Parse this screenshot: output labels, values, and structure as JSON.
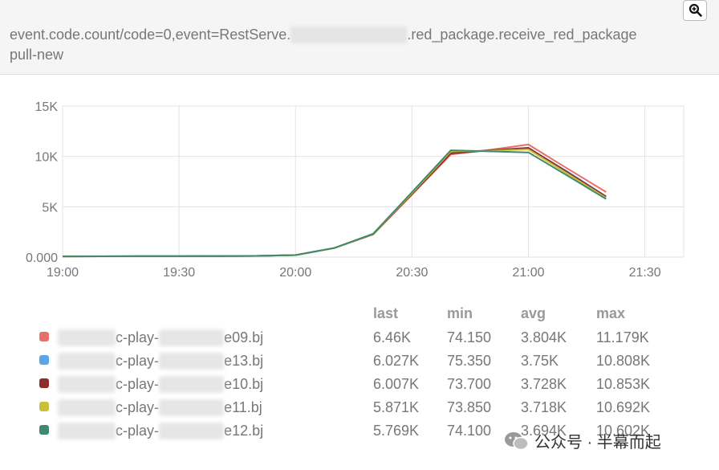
{
  "header": {
    "title_prefix": "event.code.count/code=0,event=RestServe.",
    "title_suffix": ".red_package.receive_red_package",
    "title_line2": "pull-new",
    "zoom_icon": "zoom-in-icon"
  },
  "legend": {
    "columns": [
      "last",
      "min",
      "avg",
      "max"
    ],
    "rows": [
      {
        "name_visible": "c-play-",
        "name_suffix": "e09.bj",
        "color": "#e8706a",
        "last": "6.46K",
        "min": "74.150",
        "avg": "3.804K",
        "max": "11.179K"
      },
      {
        "name_visible": "c-play-",
        "name_suffix": "e13.bj",
        "color": "#5aa7e8",
        "last": "6.027K",
        "min": "75.350",
        "avg": "3.75K",
        "max": "10.808K"
      },
      {
        "name_visible": "c-play-",
        "name_suffix": "e10.bj",
        "color": "#8b2d2d",
        "last": "6.007K",
        "min": "73.700",
        "avg": "3.728K",
        "max": "10.853K"
      },
      {
        "name_visible": "c-play-",
        "name_suffix": "e11.bj",
        "color": "#c8c23a",
        "last": "5.871K",
        "min": "73.850",
        "avg": "3.718K",
        "max": "10.692K"
      },
      {
        "name_visible": "c-play-",
        "name_suffix": "e12.bj",
        "color": "#3f8a6e",
        "last": "5.769K",
        "min": "74.100",
        "avg": "3.694K",
        "max": "10.602K"
      }
    ]
  },
  "watermark": {
    "text": "公众号 · 半幕而起",
    "icon": "wechat-icon"
  },
  "chart_data": {
    "type": "line",
    "x": [
      "19:00",
      "19:10",
      "19:20",
      "19:30",
      "19:40",
      "19:50",
      "20:00",
      "20:10",
      "20:20",
      "20:30",
      "20:40",
      "20:50",
      "21:00",
      "21:10",
      "21:20"
    ],
    "xticks": [
      "19:00",
      "19:30",
      "20:00",
      "20:30",
      "21:00",
      "21:30"
    ],
    "xlim": [
      "19:00",
      "21:40"
    ],
    "yticks": [
      "0.000",
      "5K",
      "10K",
      "15K"
    ],
    "ylim": [
      0,
      15000
    ],
    "grid": true,
    "series": [
      {
        "color": "#e8706a",
        "values": [
          74,
          80,
          85,
          90,
          100,
          120,
          200,
          900,
          2250,
          6200,
          10200,
          10650,
          11179,
          8800,
          6460
        ]
      },
      {
        "color": "#5aa7e8",
        "values": [
          75,
          80,
          85,
          90,
          100,
          120,
          200,
          900,
          2280,
          6300,
          10400,
          10600,
          10808,
          8500,
          6027
        ]
      },
      {
        "color": "#8b2d2d",
        "values": [
          74,
          80,
          85,
          90,
          100,
          120,
          200,
          900,
          2270,
          6250,
          10300,
          10600,
          10853,
          8450,
          6007
        ]
      },
      {
        "color": "#c8c23a",
        "values": [
          74,
          80,
          85,
          90,
          100,
          120,
          200,
          900,
          2300,
          6350,
          10500,
          10550,
          10692,
          8300,
          5871
        ]
      },
      {
        "color": "#3f8a6e",
        "values": [
          74,
          80,
          85,
          90,
          100,
          120,
          200,
          900,
          2320,
          6450,
          10602,
          10500,
          10400,
          8100,
          5769
        ]
      }
    ]
  }
}
